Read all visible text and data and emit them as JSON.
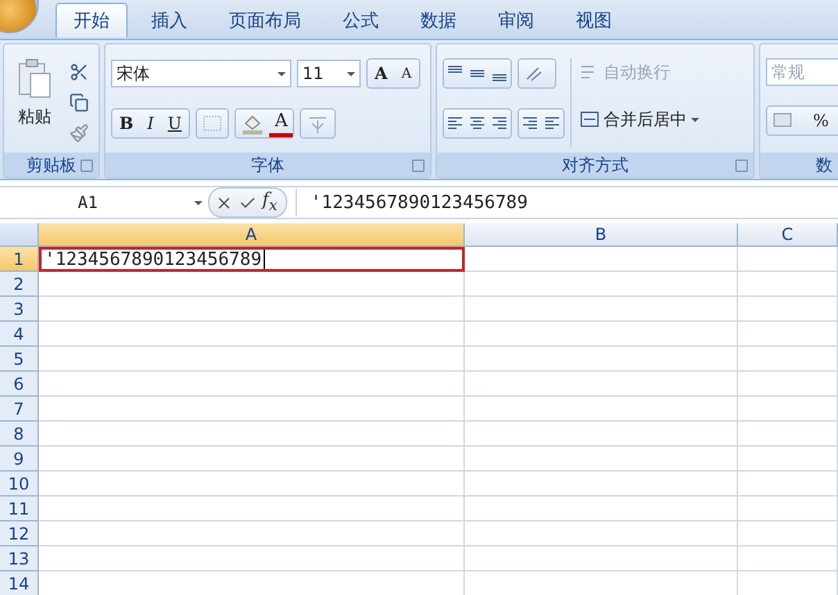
{
  "tabs": [
    {
      "label": "开始",
      "selected": true
    },
    {
      "label": "插入",
      "selected": false
    },
    {
      "label": "页面布局",
      "selected": false
    },
    {
      "label": "公式",
      "selected": false
    },
    {
      "label": "数据",
      "selected": false
    },
    {
      "label": "审阅",
      "selected": false
    },
    {
      "label": "视图",
      "selected": false
    }
  ],
  "clipboard": {
    "paste_label": "粘贴",
    "group_label": "剪贴板"
  },
  "font": {
    "name": "宋体",
    "size": "11",
    "grow": "A",
    "shrink": "A",
    "bold": "B",
    "italic": "I",
    "underline": "U",
    "color_letter": "A",
    "group_label": "字体"
  },
  "alignment": {
    "wrap_text": {
      "label": "自动换行",
      "disabled": true
    },
    "merge": {
      "label": "合并后居中",
      "disabled": false
    },
    "group_label": "对齐方式"
  },
  "number": {
    "format": {
      "value": "常规",
      "disabled": true
    },
    "percent": "%",
    "group_label": "数"
  },
  "formula_bar": {
    "name_box": "A1",
    "fx": "f$_{x}$",
    "formula": "'1234567890123456789"
  },
  "sheet": {
    "columns": [
      {
        "label": "A",
        "selected": true
      },
      {
        "label": "B",
        "selected": false
      },
      {
        "label": "C",
        "selected": false
      }
    ],
    "rows": [
      {
        "label": "1",
        "selected": true,
        "cells": [
          {
            "value": "'1234567890123456789",
            "highlighted": true
          }
        ]
      },
      {
        "label": "2",
        "selected": false
      },
      {
        "label": "3",
        "selected": false
      },
      {
        "label": "4",
        "selected": false
      },
      {
        "label": "5",
        "selected": false
      },
      {
        "label": "6",
        "selected": false
      },
      {
        "label": "7",
        "selected": false
      },
      {
        "label": "8",
        "selected": false
      },
      {
        "label": "9",
        "selected": false
      },
      {
        "label": "10",
        "selected": false
      },
      {
        "label": "11",
        "selected": false
      },
      {
        "label": "12",
        "selected": false
      },
      {
        "label": "13",
        "selected": false
      },
      {
        "label": "14",
        "selected": false
      }
    ]
  }
}
